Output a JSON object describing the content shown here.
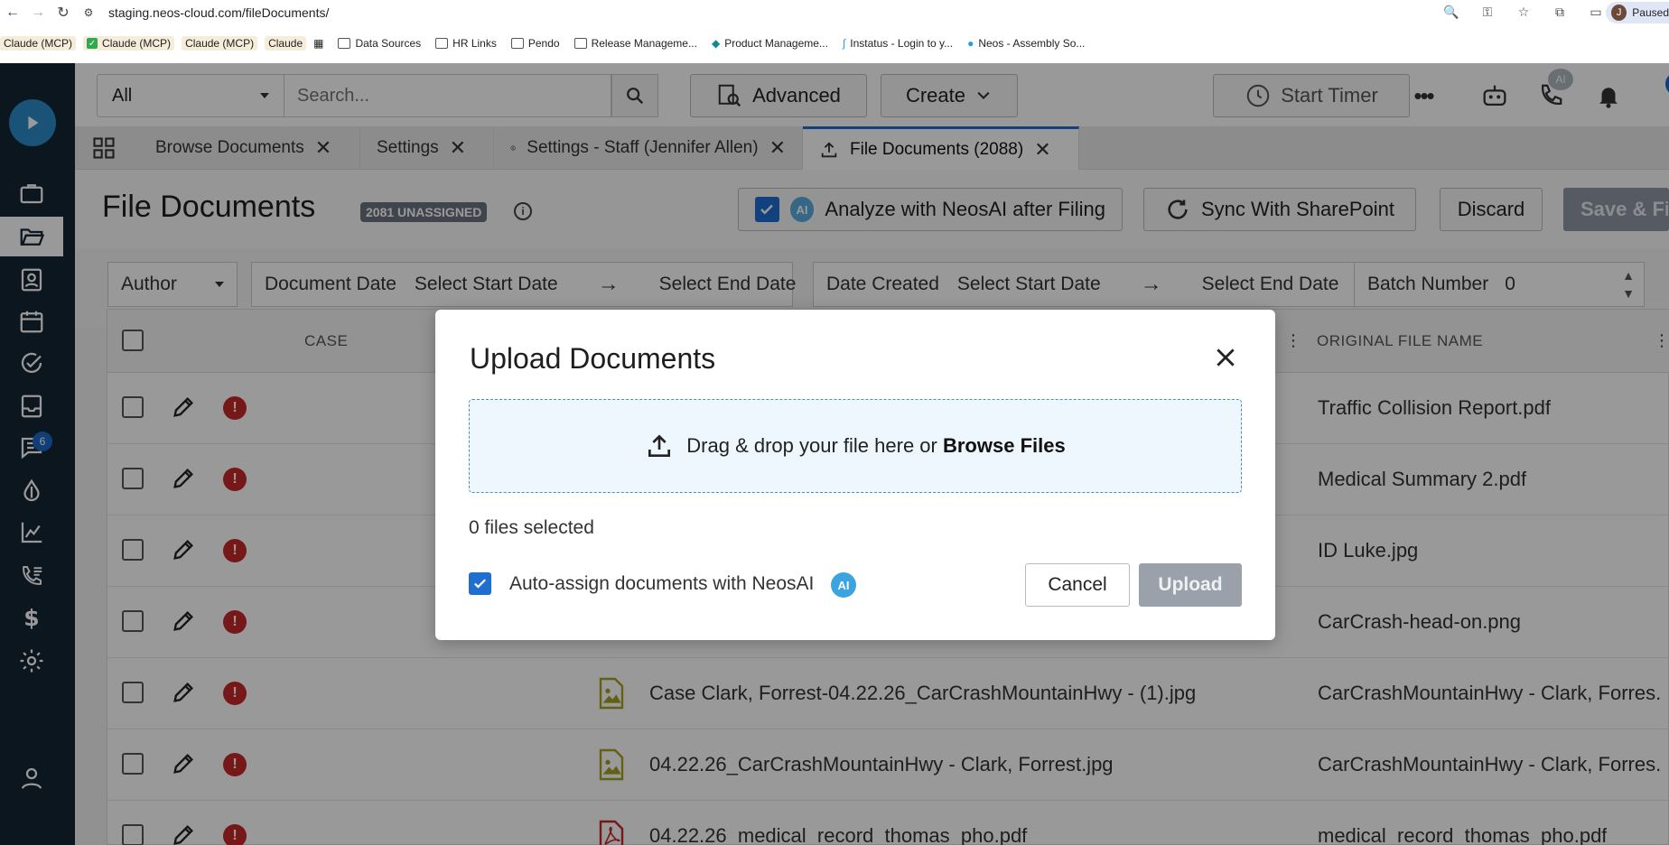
{
  "browser": {
    "url": "staging.neos-cloud.com/fileDocuments/",
    "profile_label": "Paused",
    "profile_initial": "J",
    "bookmarks": [
      {
        "label": "Claude (MCP)"
      },
      {
        "label": "Claude (MCP)"
      },
      {
        "label": "Claude (MCP)"
      },
      {
        "label": "Claude"
      },
      {
        "label": "Data Sources"
      },
      {
        "label": "HR Links"
      },
      {
        "label": "Pendo"
      },
      {
        "label": "Release Manageme..."
      },
      {
        "label": "Product Manageme..."
      },
      {
        "label": "Instatus - Login to y..."
      },
      {
        "label": "Neos - Assembly So..."
      }
    ]
  },
  "sidebar": {
    "messages_badge": "6"
  },
  "topbar": {
    "filter_value": "All",
    "search_placeholder": "Search...",
    "advanced_label": "Advanced",
    "create_label": "Create",
    "start_timer_label": "Start Timer",
    "ai_badge": "AI",
    "notification_count": "43"
  },
  "tabs": [
    {
      "label": "Browse Documents"
    },
    {
      "label": "Settings"
    },
    {
      "label": "Settings - Staff (Jennifer Allen)"
    },
    {
      "label": "File Documents (2088)"
    }
  ],
  "header": {
    "title": "File Documents",
    "unassigned_badge": "2081 UNASSIGNED",
    "info": "i",
    "analyze_label": "Analyze with NeosAI after Filing",
    "ai_badge": "AI",
    "sync_label": "Sync With SharePoint",
    "discard_label": "Discard",
    "save_label": "Save & File"
  },
  "filters": {
    "author_label": "Author",
    "doc_date_label": "Document Date",
    "doc_start": "Select Start Date",
    "doc_end": "Select End Date",
    "created_label": "Date Created",
    "created_start": "Select Start Date",
    "created_end": "Select End Date",
    "batch_label": "Batch Number",
    "batch_value": "0"
  },
  "grid": {
    "columns": {
      "case": "CASE",
      "original": "ORIGINAL FILE NAME"
    },
    "rows": [
      {
        "name": "",
        "original": "Traffic Collision Report.pdf",
        "type": ""
      },
      {
        "name": "",
        "original": "Medical Summary 2.pdf",
        "type": ""
      },
      {
        "name": "",
        "original": "ID Luke.jpg",
        "type": ""
      },
      {
        "name": "",
        "original": "CarCrash-head-on.png",
        "type": ""
      },
      {
        "name": "Case Clark, Forrest-04.22.26_CarCrashMountainHwy - (1).jpg",
        "original": "CarCrashMountainHwy - Clark, Forres...",
        "type": "image"
      },
      {
        "name": "04.22.26_CarCrashMountainHwy - Clark, Forrest.jpg",
        "original": "CarCrashMountainHwy - Clark, Forres...",
        "type": "image"
      },
      {
        "name": "04.22.26_medical_record_thomas_pho.pdf",
        "original": "medical_record_thomas_pho.pdf",
        "type": "pdf"
      }
    ]
  },
  "modal": {
    "title": "Upload Documents",
    "drop_text": "Drag & drop your file here or ",
    "browse_text": "Browse Files",
    "files_selected": "0 files selected",
    "auto_assign_label": "Auto-assign documents with NeosAI",
    "ai_badge": "AI",
    "cancel_label": "Cancel",
    "upload_label": "Upload"
  }
}
